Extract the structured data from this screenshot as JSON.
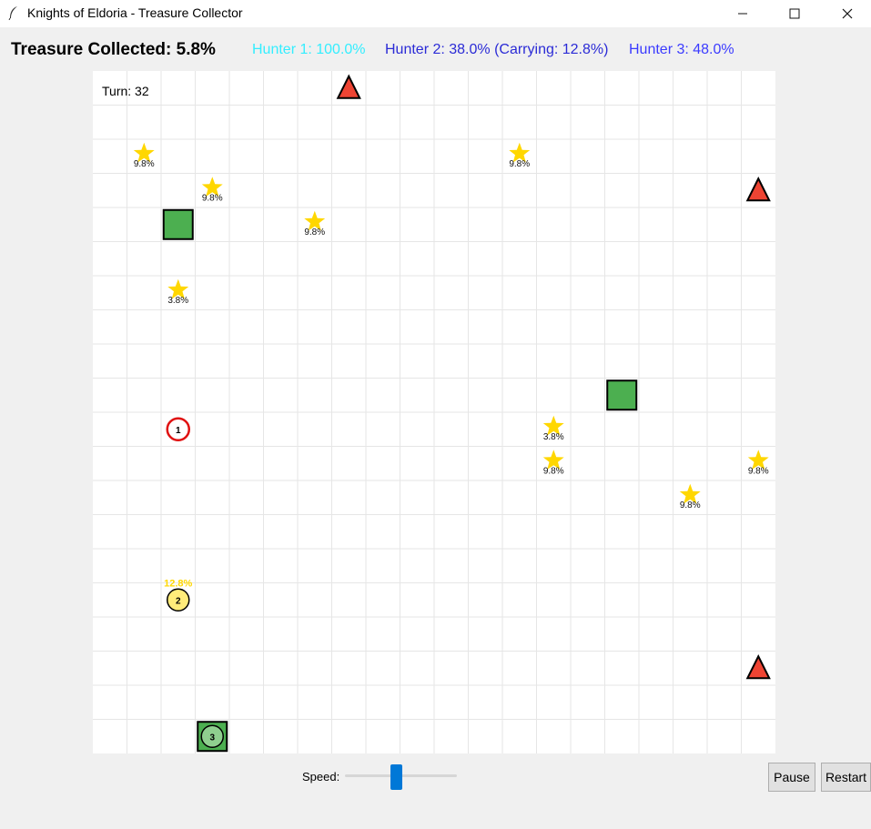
{
  "window": {
    "title": "Knights of Eldoria - Treasure Collector"
  },
  "status": {
    "collected": "Treasure Collected: 5.8%",
    "hunter1": "Hunter 1: 100.0%",
    "hunter2": "Hunter 2: 38.0% (Carrying: 12.8%)",
    "hunter3": "Hunter 3: 48.0%"
  },
  "colors": {
    "hunter1_text": "#33eeff",
    "hunter2_text": "#2b2bd6",
    "hunter3_text": "#3b3bff",
    "grid": "#e6e6e6",
    "treasure": "#ffd700",
    "hideout": "#4caf50",
    "garrison": "#ee4433",
    "hunter1": "#e01010",
    "hunter2": "#ffec7a",
    "hunter3": "#8fcf8f"
  },
  "board": {
    "turn": "Turn: 32",
    "grid_size": 20,
    "treasures": [
      {
        "col": 1,
        "row": 2,
        "label": "9.8%"
      },
      {
        "col": 3,
        "row": 3,
        "label": "9.8%"
      },
      {
        "col": 6,
        "row": 4,
        "label": "9.8%"
      },
      {
        "col": 12,
        "row": 2,
        "label": "9.8%"
      },
      {
        "col": 2,
        "row": 6,
        "label": "3.8%"
      },
      {
        "col": 13,
        "row": 10,
        "label": "3.8%"
      },
      {
        "col": 13,
        "row": 11,
        "label": "9.8%"
      },
      {
        "col": 19,
        "row": 11,
        "label": "9.8%"
      },
      {
        "col": 17,
        "row": 12,
        "label": "9.8%"
      }
    ],
    "hideouts": [
      {
        "col": 2,
        "row": 4
      },
      {
        "col": 15,
        "row": 9
      },
      {
        "col": 3,
        "row": 19
      }
    ],
    "garrisons": [
      {
        "col": 7,
        "row": 0
      },
      {
        "col": 19,
        "row": 3
      },
      {
        "col": 19,
        "row": 17
      }
    ],
    "hunters": [
      {
        "col": 2,
        "row": 10,
        "label": "1",
        "style": "ring"
      },
      {
        "col": 2,
        "row": 15,
        "label": "2",
        "style": "yellow",
        "carry": "12.8%"
      },
      {
        "col": 3,
        "row": 19,
        "label": "3",
        "style": "green"
      }
    ]
  },
  "controls": {
    "speed_label": "Speed:",
    "speed_value": 0.45,
    "pause_label": "Pause",
    "restart_label": "Restart"
  }
}
